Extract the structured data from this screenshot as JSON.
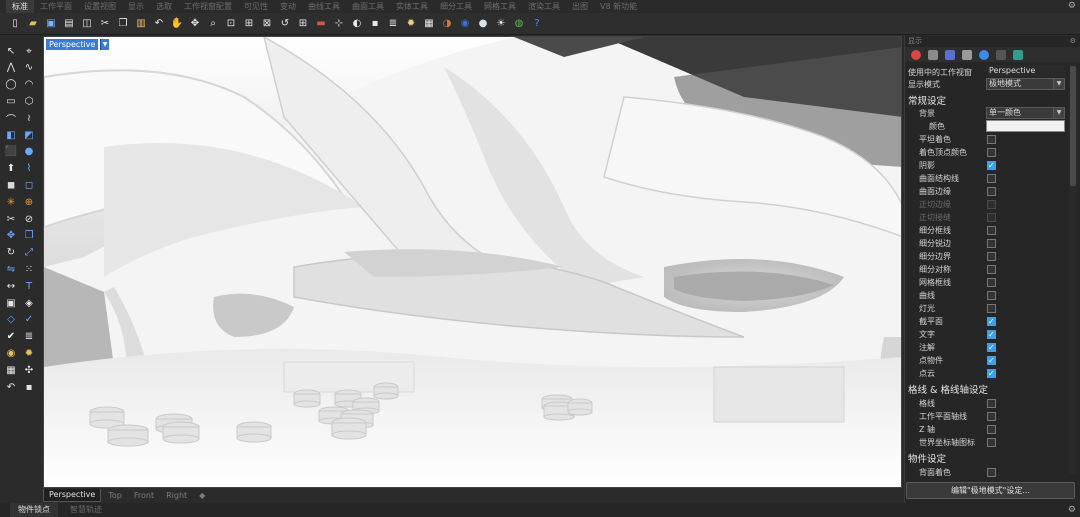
{
  "menu": {
    "tabs": [
      "标准",
      "工作平面",
      "设置视图",
      "显示",
      "选取",
      "工作视窗配置",
      "可见性",
      "变动",
      "曲线工具",
      "曲面工具",
      "实体工具",
      "细分工具",
      "网格工具",
      "渲染工具",
      "出图",
      "V8 新功能"
    ],
    "active_index": 0
  },
  "toolbar": {
    "icons": [
      "new-file-icon",
      "open-file-icon",
      "save-icon",
      "print-icon",
      "import-icon",
      "cut-icon",
      "copy-icon",
      "paste-icon",
      "undo-icon",
      "pan-icon",
      "rotate-view-icon",
      "zoom-icon",
      "zoom-window-icon",
      "zoom-extents-icon",
      "zoom-selected-icon",
      "undo-view-icon",
      "four-view-icon",
      "car-icon",
      "set-cplane-icon",
      "show-object-icon",
      "lock-icon",
      "layer-icon",
      "light-icon",
      "properties-icon",
      "shaded-icon",
      "render-icon",
      "material-icon",
      "sun-icon",
      "globe-icon",
      "help-icon"
    ]
  },
  "viewport": {
    "label": "Perspective",
    "tabs": [
      "Perspective",
      "Top",
      "Front",
      "Right",
      "◆"
    ],
    "active_tab": 0
  },
  "status": {
    "items": [
      "物件锁点",
      "智慧轨迹"
    ],
    "active_index": 0
  },
  "panel": {
    "title": "显示",
    "gear": "⚙",
    "viewport_label": "使用中的工作视窗",
    "viewport_value": "Perspective",
    "display_mode_label": "显示模式",
    "display_mode_value": "极地模式",
    "general_heading": "常规设定",
    "background_label": "背景",
    "background_value": "单一颜色",
    "color_label": "颜色",
    "options": [
      {
        "label": "平坦着色",
        "checked": false,
        "disabled": false
      },
      {
        "label": "着色顶点颜色",
        "checked": false,
        "disabled": false
      },
      {
        "label": "阴影",
        "checked": true,
        "disabled": false
      },
      {
        "label": "曲面结构线",
        "checked": false,
        "disabled": false
      },
      {
        "label": "曲面边缘",
        "checked": false,
        "disabled": false
      },
      {
        "label": "正切边缘",
        "checked": false,
        "disabled": true
      },
      {
        "label": "正切接缝",
        "checked": false,
        "disabled": true
      },
      {
        "label": "细分框线",
        "checked": false,
        "disabled": false
      },
      {
        "label": "细分锐边",
        "checked": false,
        "disabled": false
      },
      {
        "label": "细分边界",
        "checked": false,
        "disabled": false
      },
      {
        "label": "细分对称",
        "checked": false,
        "disabled": false
      },
      {
        "label": "网格框线",
        "checked": false,
        "disabled": false
      },
      {
        "label": "曲线",
        "checked": false,
        "disabled": false
      },
      {
        "label": "灯光",
        "checked": false,
        "disabled": false
      },
      {
        "label": "截平面",
        "checked": true,
        "disabled": false
      },
      {
        "label": "文字",
        "checked": true,
        "disabled": false
      },
      {
        "label": "注解",
        "checked": true,
        "disabled": false
      },
      {
        "label": "点物件",
        "checked": true,
        "disabled": false
      },
      {
        "label": "点云",
        "checked": true,
        "disabled": false
      }
    ],
    "grid_heading": "格线 & 格线轴设定",
    "grid_options": [
      {
        "label": "格线",
        "checked": false
      },
      {
        "label": "工作平面轴线",
        "checked": false
      },
      {
        "label": "Z 轴",
        "checked": false
      },
      {
        "label": "世界坐标轴图标",
        "checked": false
      }
    ],
    "object_heading": "物件设定",
    "object_options": [
      {
        "label": "背面着色",
        "checked": false
      }
    ],
    "edit_button": "编辑\"极地模式\"设定..."
  },
  "colors": {
    "accent": "#3b7bd6",
    "checkbox_on": "#3aa0e8",
    "panel_bg": "#262626"
  }
}
